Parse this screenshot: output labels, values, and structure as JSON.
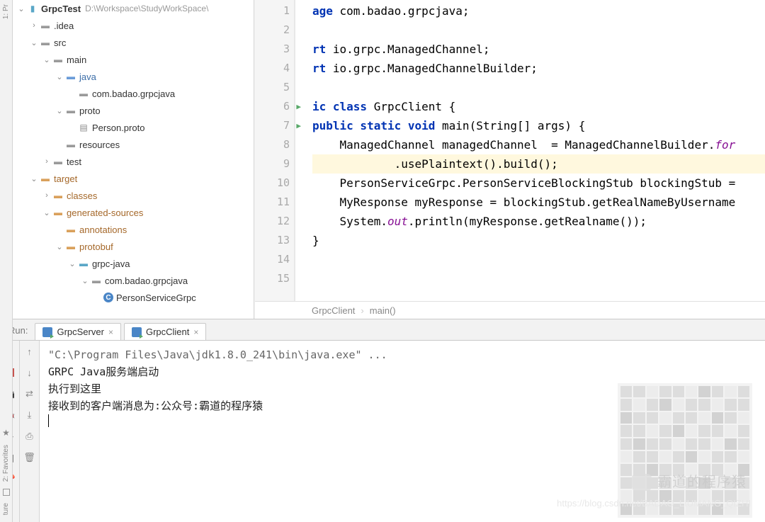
{
  "leftGutter": {
    "label": "1: Pr"
  },
  "project": {
    "root": {
      "name": "GrpcTest",
      "path": "D:\\Workspace\\StudyWorkSpace\\"
    },
    "tree": [
      {
        "indent": 1,
        "arrow": "right",
        "iconClass": "folder-gray",
        "label": ".idea"
      },
      {
        "indent": 1,
        "arrow": "down",
        "iconClass": "folder-gray",
        "label": "src"
      },
      {
        "indent": 2,
        "arrow": "down",
        "iconClass": "folder-gray",
        "label": "main"
      },
      {
        "indent": 3,
        "arrow": "down",
        "iconClass": "folder-blue",
        "label": "java",
        "blue": true
      },
      {
        "indent": 4,
        "arrow": "",
        "iconClass": "folder-gray",
        "label": "com.badao.grpcjava"
      },
      {
        "indent": 3,
        "arrow": "down",
        "iconClass": "folder-gray",
        "label": "proto"
      },
      {
        "indent": 4,
        "arrow": "",
        "iconClass": "file-gray",
        "label": "Person.proto",
        "file": true
      },
      {
        "indent": 3,
        "arrow": "",
        "iconClass": "folder-gray",
        "label": "resources"
      },
      {
        "indent": 2,
        "arrow": "right",
        "iconClass": "folder-gray",
        "label": "test"
      },
      {
        "indent": 1,
        "arrow": "down",
        "iconClass": "folder-orange",
        "label": "target",
        "orange": true
      },
      {
        "indent": 2,
        "arrow": "right",
        "iconClass": "folder-orange",
        "label": "classes",
        "orange": true
      },
      {
        "indent": 2,
        "arrow": "down",
        "iconClass": "folder-orange",
        "label": "generated-sources",
        "orange": true
      },
      {
        "indent": 3,
        "arrow": "",
        "iconClass": "folder-orange",
        "label": "annotations",
        "orange": true
      },
      {
        "indent": 3,
        "arrow": "down",
        "iconClass": "folder-orange",
        "label": "protobuf",
        "orange": true
      },
      {
        "indent": 4,
        "arrow": "down",
        "iconClass": "folder-cyan",
        "label": "grpc-java"
      },
      {
        "indent": 5,
        "arrow": "down",
        "iconClass": "folder-gray",
        "label": "com.badao.grpcjava"
      },
      {
        "indent": 6,
        "arrow": "",
        "iconClass": "file-c",
        "label": "PersonServiceGrpc",
        "circ": true
      }
    ]
  },
  "editor": {
    "code": [
      {
        "n": 1,
        "tokens": [
          {
            "t": "age ",
            "c": "kw"
          },
          {
            "t": "com.badao.grpcjava;",
            "c": "ident"
          }
        ]
      },
      {
        "n": 2,
        "tokens": []
      },
      {
        "n": 3,
        "tokens": [
          {
            "t": "rt ",
            "c": "kw"
          },
          {
            "t": "io.grpc.ManagedChannel;",
            "c": "ident"
          }
        ]
      },
      {
        "n": 4,
        "tokens": [
          {
            "t": "rt ",
            "c": "kw"
          },
          {
            "t": "io.grpc.ManagedChannelBuilder;",
            "c": "ident"
          }
        ]
      },
      {
        "n": 5,
        "tokens": []
      },
      {
        "n": 6,
        "run": true,
        "tokens": [
          {
            "t": "ic class ",
            "c": "kw"
          },
          {
            "t": "GrpcClient ",
            "c": "cls"
          },
          {
            "t": "{",
            "c": "punct"
          }
        ]
      },
      {
        "n": 7,
        "run": true,
        "tokens": [
          {
            "t": "public static void ",
            "c": "kw"
          },
          {
            "t": "main",
            "c": "method"
          },
          {
            "t": "(String[] args) {",
            "c": "punct"
          }
        ]
      },
      {
        "n": 8,
        "tokens": [
          {
            "t": "    ManagedChannel managedChannel  = ManagedChannelBuilder.",
            "c": "ident"
          },
          {
            "t": "for",
            "c": "field-static"
          }
        ]
      },
      {
        "n": 9,
        "hl": true,
        "tokens": [
          {
            "t": "            .usePlaintext().build();",
            "c": "ident"
          }
        ]
      },
      {
        "n": 10,
        "tokens": [
          {
            "t": "    PersonServiceGrpc.PersonServiceBlockingStub blockingStub =",
            "c": "ident"
          }
        ]
      },
      {
        "n": 11,
        "tokens": [
          {
            "t": "    MyResponse myResponse = blockingStub.getRealNameByUsername",
            "c": "ident"
          }
        ]
      },
      {
        "n": 12,
        "tokens": [
          {
            "t": "    System.",
            "c": "ident"
          },
          {
            "t": "out",
            "c": "field-static"
          },
          {
            "t": ".println(myResponse.getRealname());",
            "c": "ident"
          }
        ]
      },
      {
        "n": 13,
        "tokens": [
          {
            "t": "}",
            "c": "punct"
          }
        ]
      },
      {
        "n": 14,
        "tokens": []
      },
      {
        "n": 15,
        "tokens": []
      }
    ]
  },
  "breadcrumb": {
    "parts": [
      "GrpcClient",
      "main()"
    ]
  },
  "run": {
    "label": "Run:",
    "tabs": [
      {
        "name": "GrpcServer",
        "active": true
      },
      {
        "name": "GrpcClient",
        "active": false
      }
    ],
    "console": [
      {
        "text": "\"C:\\Program Files\\Java\\jdk1.8.0_241\\bin\\java.exe\" ...",
        "cmd": true
      },
      {
        "text": "GRPC Java服务端启动"
      },
      {
        "text": "执行到这里"
      },
      {
        "text": "接收到的客户端消息为:公众号:霸道的程序猿"
      }
    ]
  },
  "leftBottomGutter": {
    "fav": "2: Favorites",
    "ture": "ture"
  },
  "watermark": {
    "text": "霸道的程序猿",
    "url": "https://blog.csdn.net/BADAO_LIUMANG_QIZHI"
  }
}
